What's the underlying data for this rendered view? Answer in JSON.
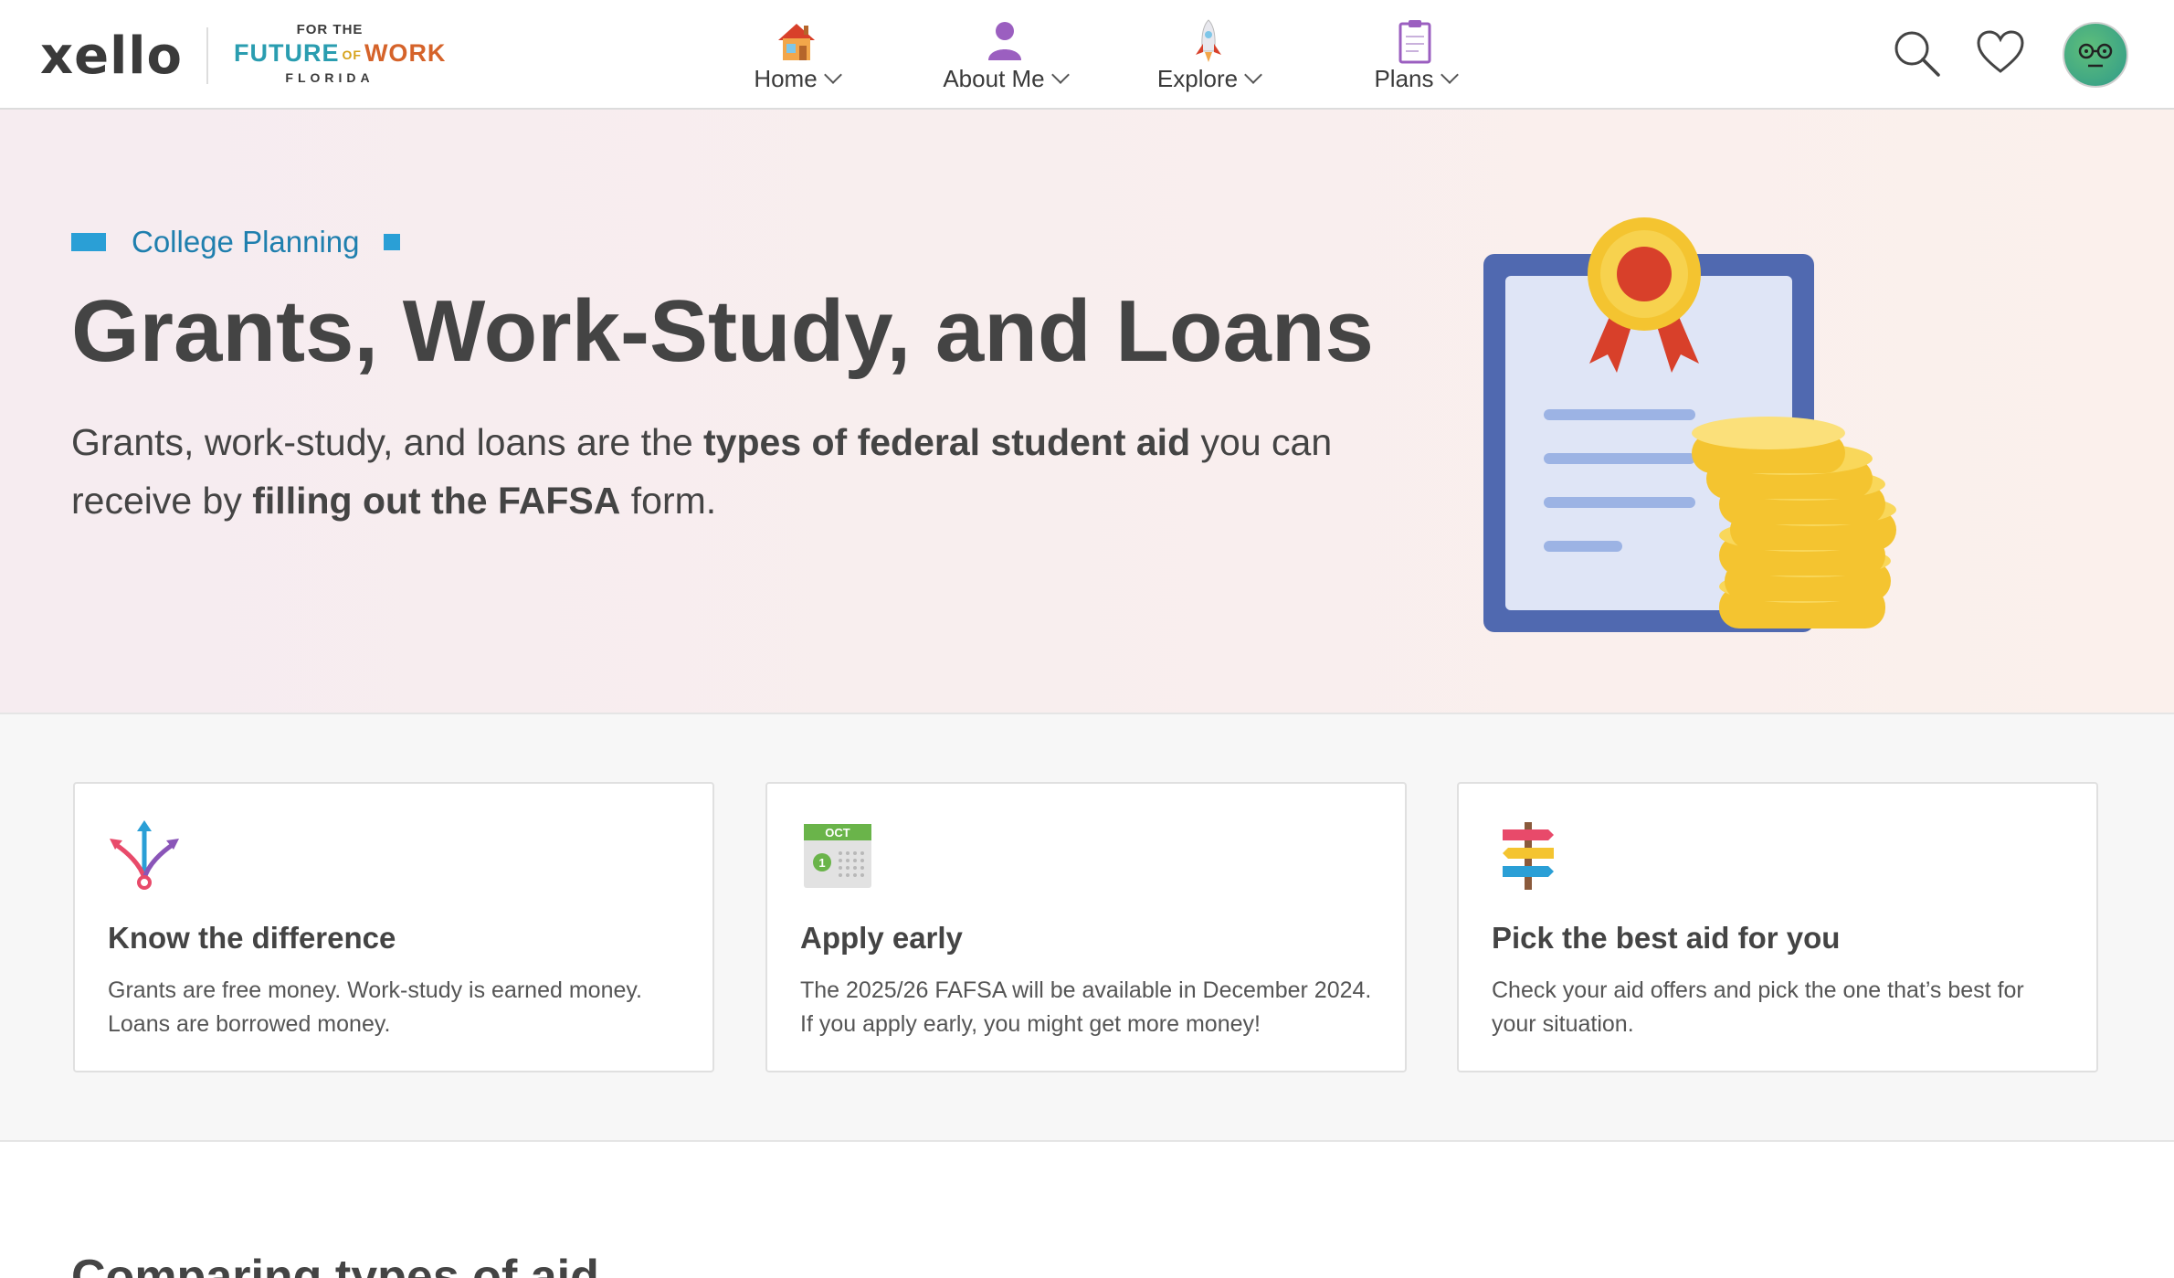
{
  "header": {
    "logo_text": "xello",
    "partner": {
      "line1": "FOR THE",
      "line2_a": "FUTURE",
      "line2_b": "OF",
      "line2_c": "WORK",
      "line3": "FLORIDA"
    },
    "nav": [
      {
        "label": "Home",
        "icon": "house-icon"
      },
      {
        "label": "About Me",
        "icon": "person-icon"
      },
      {
        "label": "Explore",
        "icon": "rocket-icon"
      },
      {
        "label": "Plans",
        "icon": "clipboard-icon"
      }
    ],
    "tools": [
      "search-icon",
      "heart-icon",
      "avatar"
    ]
  },
  "hero": {
    "eyebrow": "College Planning",
    "title": "Grants, Work-Study, and Loans",
    "lead_1": "Grants, work-study, and loans are the ",
    "lead_bold_1": "types of federal student aid",
    "lead_2": " you can receive by ",
    "lead_bold_2": "filling out the FAFSA",
    "lead_3": " form.",
    "illustration": "certificate-with-coins"
  },
  "cards": [
    {
      "icon": "diverging-arrows-icon",
      "title": "Know the difference",
      "body": "Grants are free money. Work-study is earned money. Loans are borrowed money."
    },
    {
      "icon": "calendar-icon",
      "calendar_month": "OCT",
      "calendar_day": "1",
      "title": "Apply early",
      "body": "The 2025/26 FAFSA will be available in December 2024. If you apply early, you might get more money!"
    },
    {
      "icon": "signpost-icon",
      "title": "Pick the best aid for you",
      "body": "Check your aid offers and pick the one that’s best for your situation."
    }
  ],
  "section2": {
    "title": "Comparing types of aid"
  },
  "colors": {
    "accent": "#2a9fd6",
    "text": "#444444",
    "coin": "#f4c430",
    "certificate": "#4f6db5",
    "ribbon": "#d8402a"
  }
}
